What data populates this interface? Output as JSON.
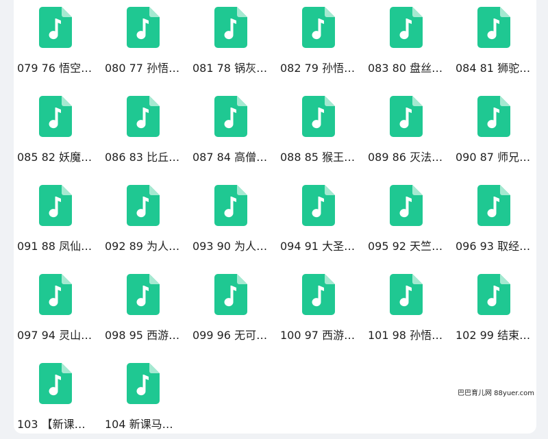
{
  "colors": {
    "icon_fill": "#1fc892",
    "icon_fold": "#a5e9d1",
    "note": "#ffffff"
  },
  "file_icon_name": "music-file-icon",
  "files": [
    "079 76 悟空…",
    "080 77 孙悟…",
    "081 78 锅灰…",
    "082 79 孙悟…",
    "083 80 盘丝…",
    "084 81 狮驼…",
    "085 82 妖魔…",
    "086 83 比丘…",
    "087 84 高僧…",
    "088 85 猴王…",
    "089 86 灭法…",
    "090 87 师兄…",
    "091 88 凤仙…",
    "092 89 为人…",
    "093 90 为人…",
    "094 91 大圣…",
    "095 92 天竺…",
    "096 93 取经…",
    "097 94 灵山…",
    "098 95 西游…",
    "099 96 无可…",
    "100 97 西游…",
    "101 98 孙悟…",
    "102 99 结束…",
    "103 【新课…",
    "104 新课马…"
  ],
  "watermark": "巴巴育儿网 88yuer.com"
}
